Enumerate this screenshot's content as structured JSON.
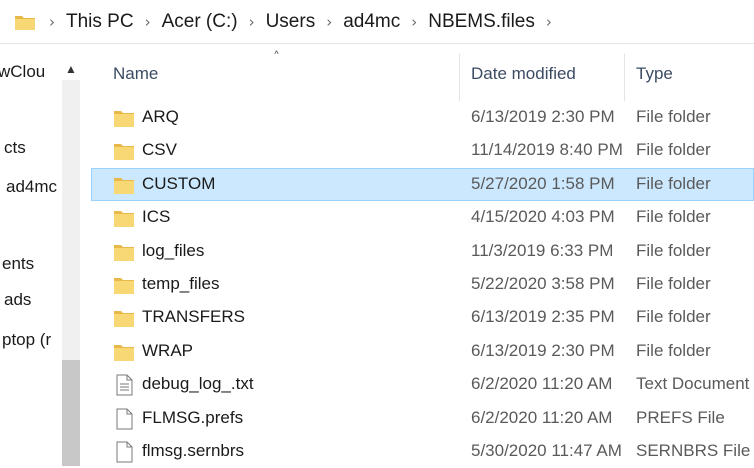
{
  "address_bar": {
    "breadcrumbs": [
      "This PC",
      "Acer (C:)",
      "Users",
      "ad4mc",
      "NBEMS.files"
    ],
    "folder_icon": "folder-icon",
    "separator_icon": "chevron-right-icon"
  },
  "nav_pane": {
    "items": [
      {
        "label": "wClou"
      },
      {
        "label": "cts"
      },
      {
        "label": "ad4mc"
      },
      {
        "label": "ents"
      },
      {
        "label": "ads"
      },
      {
        "label": "ptop (r"
      }
    ]
  },
  "columns": {
    "name": "Name",
    "date_modified": "Date modified",
    "type": "Type"
  },
  "files": [
    {
      "name": "ARQ",
      "date": "6/13/2019 2:30 PM",
      "type": "File folder",
      "icon": "folder-icon",
      "selected": false
    },
    {
      "name": "CSV",
      "date": "11/14/2019 8:40 PM",
      "type": "File folder",
      "icon": "folder-icon",
      "selected": false
    },
    {
      "name": "CUSTOM",
      "date": "5/27/2020 1:58 PM",
      "type": "File folder",
      "icon": "folder-icon",
      "selected": true
    },
    {
      "name": "ICS",
      "date": "4/15/2020 4:03 PM",
      "type": "File folder",
      "icon": "folder-icon",
      "selected": false
    },
    {
      "name": "log_files",
      "date": "11/3/2019 6:33 PM",
      "type": "File folder",
      "icon": "folder-icon",
      "selected": false
    },
    {
      "name": "temp_files",
      "date": "5/22/2020 3:58 PM",
      "type": "File folder",
      "icon": "folder-icon",
      "selected": false
    },
    {
      "name": "TRANSFERS",
      "date": "6/13/2019 2:35 PM",
      "type": "File folder",
      "icon": "folder-icon",
      "selected": false
    },
    {
      "name": "WRAP",
      "date": "6/13/2019 2:30 PM",
      "type": "File folder",
      "icon": "folder-icon",
      "selected": false
    },
    {
      "name": "debug_log_.txt",
      "date": "6/2/2020 11:20 AM",
      "type": "Text Document",
      "icon": "text-file-icon",
      "selected": false
    },
    {
      "name": "FLMSG.prefs",
      "date": "6/2/2020 11:20 AM",
      "type": "PREFS File",
      "icon": "file-icon",
      "selected": false
    },
    {
      "name": "flmsg.sernbrs",
      "date": "5/30/2020 11:47 AM",
      "type": "SERNBRS File",
      "icon": "file-icon",
      "selected": false
    }
  ],
  "colors": {
    "folder_fill": "#f8d775",
    "folder_tab": "#e8b94a",
    "selected_bg": "#cce8ff",
    "selected_border": "#99d1ff",
    "header_text": "#3c4b64"
  }
}
